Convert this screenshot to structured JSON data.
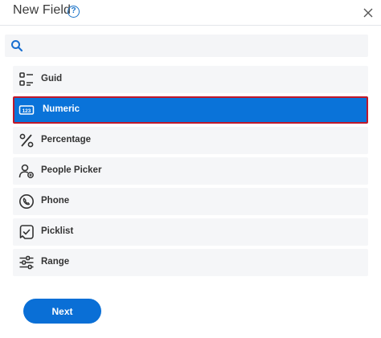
{
  "dialog": {
    "title": "New Field",
    "help_icon": "help-icon",
    "help_glyph": "?",
    "close_icon": "close-icon"
  },
  "search": {
    "icon": "search-icon",
    "placeholder": "",
    "value": ""
  },
  "field_types": [
    {
      "label": "Guid",
      "icon": "guid-icon",
      "selected": false
    },
    {
      "label": "Numeric",
      "icon": "numeric-icon",
      "selected": true
    },
    {
      "label": "Percentage",
      "icon": "percentage-icon",
      "selected": false
    },
    {
      "label": "People Picker",
      "icon": "people-picker-icon",
      "selected": false
    },
    {
      "label": "Phone",
      "icon": "phone-icon",
      "selected": false
    },
    {
      "label": "Picklist",
      "icon": "picklist-icon",
      "selected": false
    },
    {
      "label": "Range",
      "icon": "range-icon",
      "selected": false
    }
  ],
  "footer": {
    "next_label": "Next"
  },
  "colors": {
    "accent": "#0a73d9",
    "selected_border": "#c0182a",
    "item_bg": "#f5f6f8"
  }
}
